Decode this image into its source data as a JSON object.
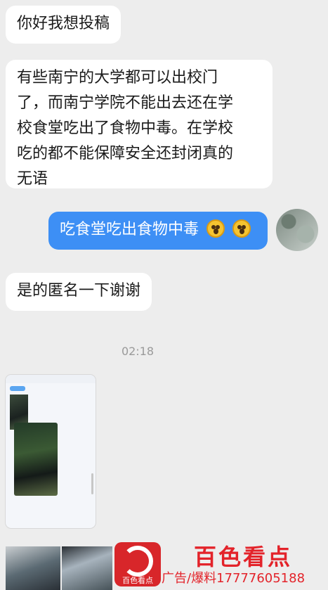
{
  "messages": [
    {
      "side": "left",
      "text": "你好我想投稿"
    },
    {
      "side": "left",
      "lines": [
        "有些南宁的大学都可以出校门",
        "了，而南宁学院不能出去还在学",
        "校食堂吃出了食物中毒。在学校",
        "吃的都不能保障安全还封闭真的",
        "无语"
      ]
    },
    {
      "side": "right",
      "text": "吃食堂吃出食物中毒",
      "emoji": [
        "astonished-face-icon",
        "astonished-face-icon"
      ]
    },
    {
      "side": "left",
      "text": "是的匿名一下谢谢"
    }
  ],
  "timestamp": "02:18",
  "watermark": {
    "logo_text": "百色看点",
    "brand": "百色看点",
    "ad_text": "广告/爆料17777605188"
  },
  "colors": {
    "background": "#ededed",
    "outgoing_bubble": "#3d8ff5",
    "incoming_bubble": "#ffffff",
    "brand_red": "#e3232a"
  }
}
